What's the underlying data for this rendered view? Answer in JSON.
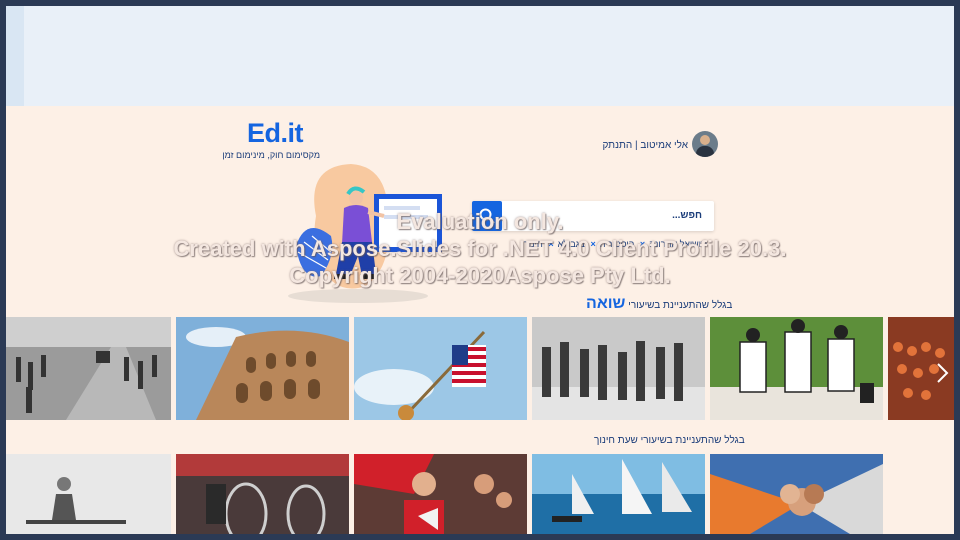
{
  "header": {
    "logo_text": "Ed.it",
    "logo_tagline": "מקסימום חוק, מינימום זמן",
    "user_text": "אלי אמיטוב | התנתק"
  },
  "search": {
    "placeholder": "חפש...",
    "tags": [
      {
        "label": "סושיאל אחרונה"
      },
      {
        "label": "היסטוריה"
      },
      {
        "label": "בגבולא"
      },
      {
        "label": "חינוך"
      }
    ]
  },
  "rows": [
    {
      "title_prefix": "בגלל שהתעניינת בשיעורי",
      "title_accent": "שואה",
      "tiles": [
        {
          "name": "soldiers-road-photo"
        },
        {
          "name": "colosseum-photo"
        },
        {
          "name": "american-flag-photo"
        },
        {
          "name": "crowd-march-photo"
        },
        {
          "name": "cartoon-figures-photo"
        },
        {
          "name": "stadium-crowd-photo"
        }
      ]
    },
    {
      "title_prefix": "בגלל שהתעניינת בשיעורי שעת חינוך",
      "title_accent": "",
      "tiles": [
        {
          "name": "sad-girl-photo"
        },
        {
          "name": "wheelchair-race-photo"
        },
        {
          "name": "protest-megaphone-photo"
        },
        {
          "name": "sailboats-photo"
        },
        {
          "name": "stacked-hands-photo"
        }
      ]
    }
  ],
  "watermark": {
    "line1": "Evaluation only.",
    "line2": "Created with Aspose.Slides for .NET 4.0 Client Profile 20.3.",
    "line3": "Copyright 2004-2020Aspose Pty Ltd."
  },
  "colors": {
    "brand_blue": "#1565e0",
    "navy_text": "#1b3d7a",
    "background": "#fdf0e6",
    "top_band": "#e9f0f8"
  }
}
